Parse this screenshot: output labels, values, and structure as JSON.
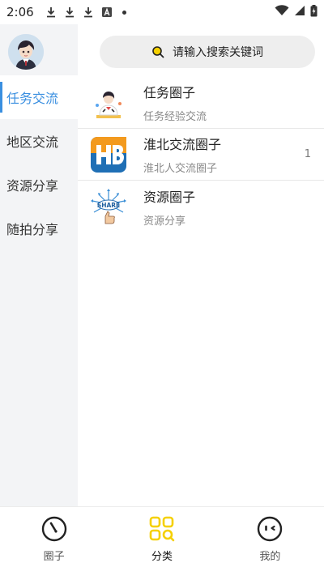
{
  "status_bar": {
    "time": "2:06",
    "icons": [
      "download-icon",
      "download-icon",
      "download-icon",
      "a-square-icon",
      "dot-icon",
      "wifi-icon",
      "signal-icon",
      "battery-charging-icon"
    ]
  },
  "search": {
    "placeholder": "请输入搜索关键词",
    "icon": "search-icon"
  },
  "sidebar": {
    "items": [
      {
        "label": "任务交流",
        "active": true
      },
      {
        "label": "地区交流",
        "active": false
      },
      {
        "label": "资源分享",
        "active": false
      },
      {
        "label": "随拍分享",
        "active": false
      }
    ]
  },
  "circles": [
    {
      "name": "任务圈子",
      "desc": "任务经验交流",
      "count": ""
    },
    {
      "name": "淮北交流圈子",
      "desc": "淮北人交流圈子",
      "count": "1"
    },
    {
      "name": "资源圈子",
      "desc": "资源分享",
      "count": ""
    }
  ],
  "bottom_nav": {
    "items": [
      {
        "label": "圈子",
        "icon": "compass-icon",
        "active": false
      },
      {
        "label": "分类",
        "icon": "category-grid-icon",
        "active": true
      },
      {
        "label": "我的",
        "icon": "face-icon",
        "active": false
      }
    ]
  },
  "colors": {
    "accent_blue": "#3a8fe0",
    "nav_active_yellow": "#f5d000",
    "sidebar_bg": "#f3f4f6"
  }
}
